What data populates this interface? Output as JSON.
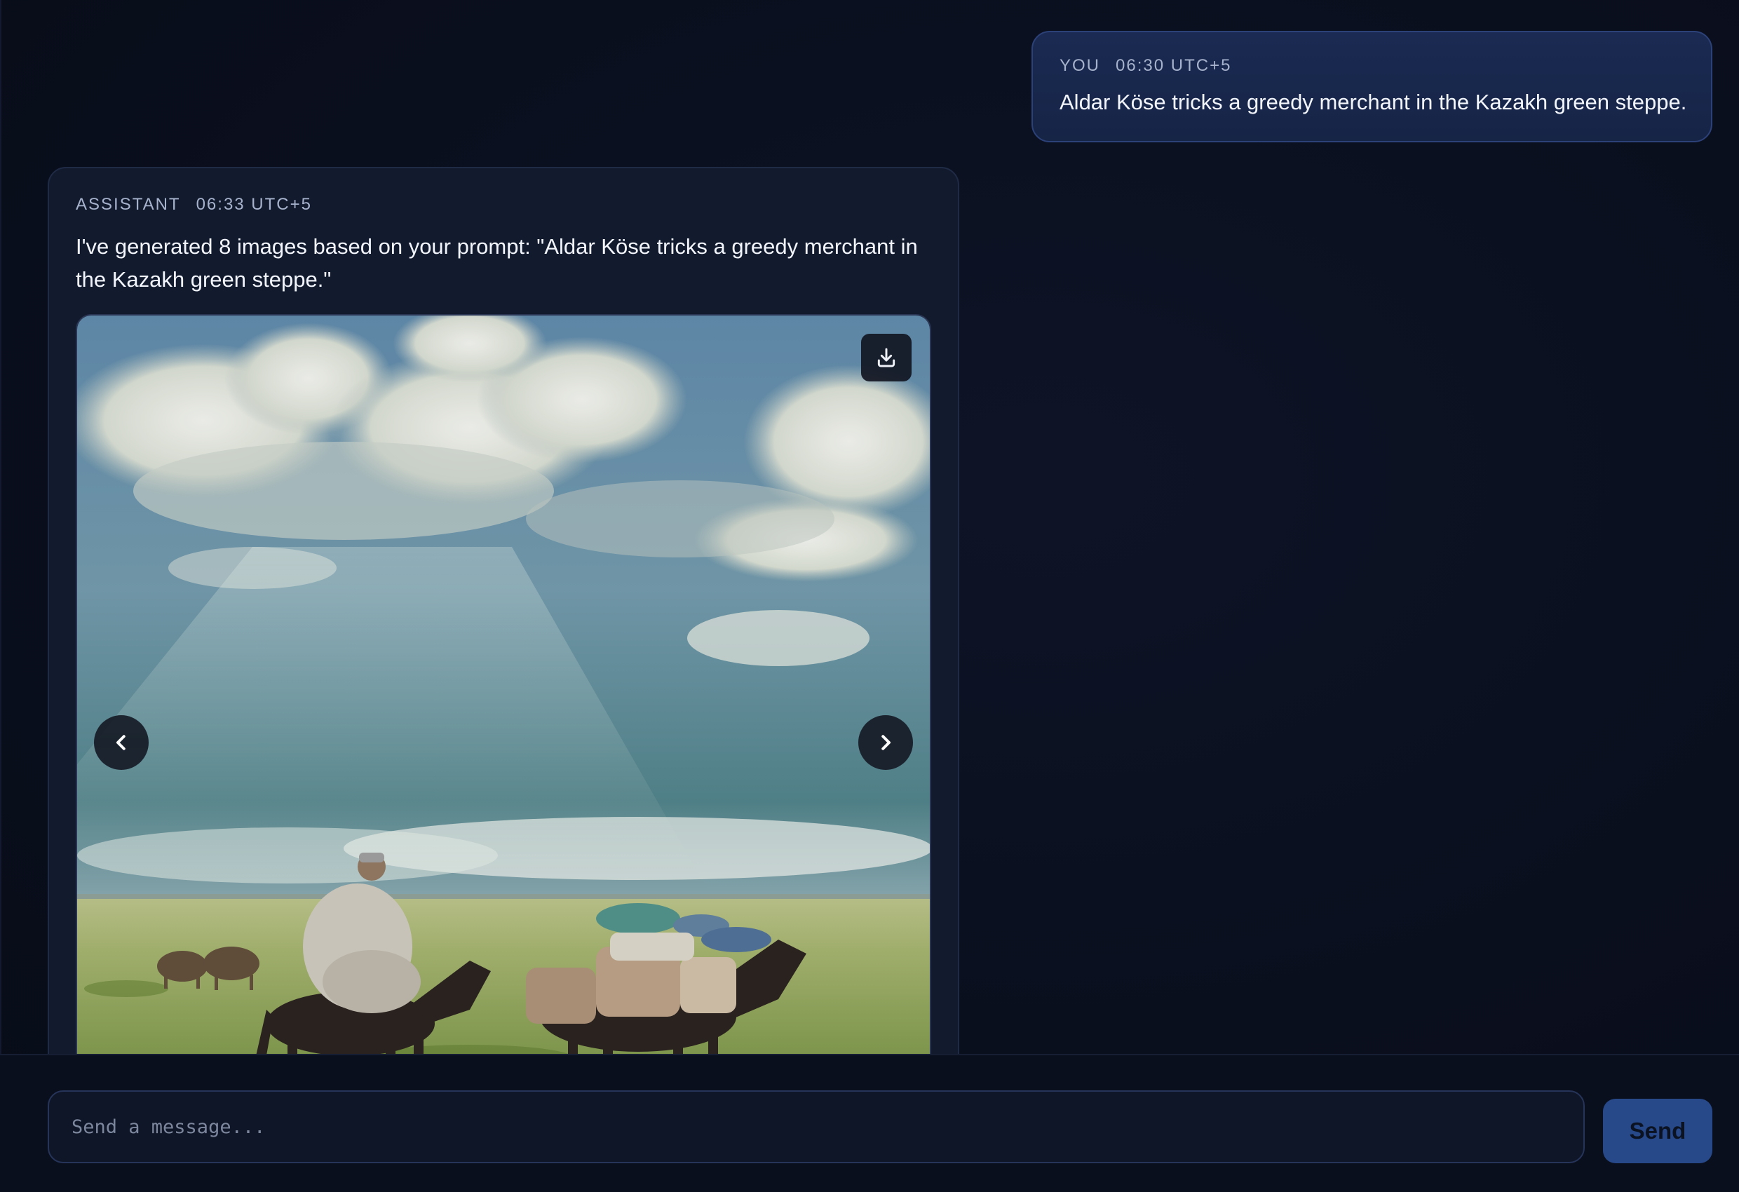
{
  "messages": {
    "user": {
      "role": "YOU",
      "time": "06:30 UTC+5",
      "text": "Aldar Köse tricks a greedy merchant in the Kazakh green steppe."
    },
    "assistant": {
      "role": "ASSISTANT",
      "time": "06:33 UTC+5",
      "text": "I've generated 8 images based on your prompt: \"Aldar Köse tricks a greedy merchant in the Kazakh green steppe.\""
    }
  },
  "carousel": {
    "image_count": 8,
    "icons": {
      "download": "download-icon",
      "prev": "chevron-left-icon",
      "next": "chevron-right-icon"
    }
  },
  "composer": {
    "placeholder": "Send a message...",
    "value": "",
    "send_label": "Send"
  },
  "colors": {
    "background": "#0b1020",
    "user_bubble": "#1a2a52",
    "assistant_bubble": "#121a2e",
    "send_button": "#27498a"
  }
}
